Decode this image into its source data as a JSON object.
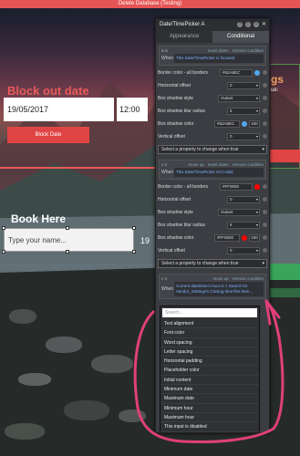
{
  "window": {
    "title": "Delete Database (Testing)"
  },
  "page": {
    "block_title": "Block out date",
    "date_value": "19/05/2017",
    "time_value": "12:00",
    "block_button": "Block Date",
    "book_title": "Book Here",
    "name_placeholder": "Type your name...",
    "partial_right": "19",
    "right_heading": "gs",
    "right_small": "ue:"
  },
  "panel": {
    "title": "Date/TimePicker A",
    "tabs": [
      "Appearance",
      "Conditional"
    ],
    "condition1": {
      "top_links": [
        "tion",
        "move down",
        "remove condition"
      ],
      "when_label": "When",
      "when_expr": "This Date/TimePicker is focused",
      "rows": [
        {
          "label": "Border color - all borders",
          "value": "#52A8EC",
          "swatch": "#52A8EC"
        },
        {
          "label": "Horizontal offset",
          "value": "0"
        },
        {
          "label": "Box shadow style",
          "value": "Outset"
        },
        {
          "label": "Box shadow blur radius",
          "value": "6"
        },
        {
          "label": "Box shadow color",
          "value": "#52A8EC",
          "swatch": "#52A8EC",
          "num": "100"
        },
        {
          "label": "Vertical offset",
          "value": "0"
        }
      ],
      "select": "Select a property to change when true"
    },
    "condition2": {
      "top_links": [
        "n 2",
        "move up",
        "move down",
        "remove condition"
      ],
      "when_label": "When",
      "when_expr": "This Date/TimePicker isn't valid",
      "rows": [
        {
          "label": "Border color - all borders",
          "value": "#FF0000",
          "swatch": "#FF0000"
        },
        {
          "label": "Horizontal offset",
          "value": "0"
        },
        {
          "label": "Box shadow style",
          "value": "Outset"
        },
        {
          "label": "Box shadow blur radius",
          "value": "6"
        },
        {
          "label": "Box shadow color",
          "value": "#FF0000",
          "swatch": "#FF0000",
          "num": "100"
        },
        {
          "label": "Vertical offset",
          "value": "0"
        }
      ],
      "select": "Select a property to change when true"
    },
    "condition3": {
      "top_links": [
        "n 3",
        "move up",
        "remove condition"
      ],
      "when_label": "When",
      "when_expr": "Current date/time's hour is < Search for Vendor_Settings's Closing time:first item..."
    }
  },
  "dropdown": {
    "search_placeholder": "Search...",
    "items": [
      "Text alignment",
      "Font color",
      "Word spacing",
      "Letter spacing",
      "Horizontal padding",
      "Placeholder color",
      "Initial content",
      "Minimum date",
      "Maximum date",
      "Minimum hour",
      "Maximum hour",
      "This input is disabled"
    ]
  },
  "colors": {
    "accent": "#e85a5a",
    "annotation": "#e0407a",
    "link": "#7fb3ff"
  }
}
